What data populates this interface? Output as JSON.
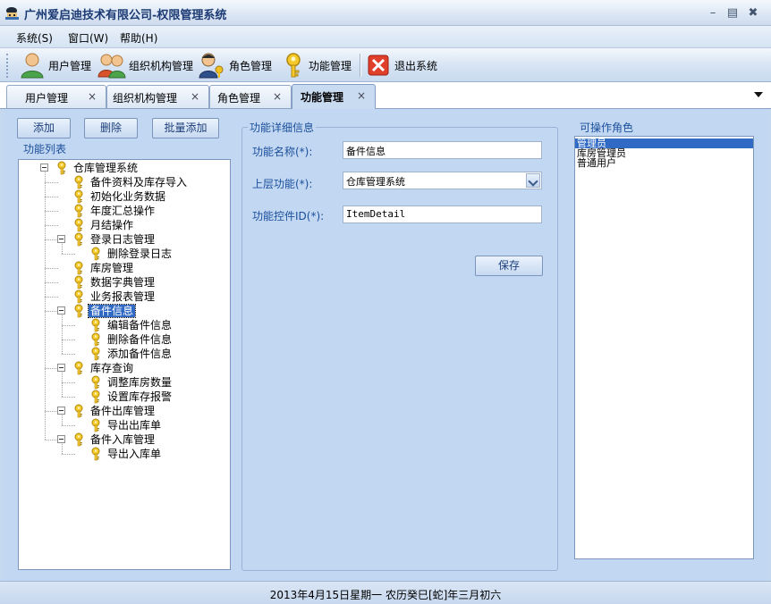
{
  "window": {
    "title": "广州爱启迪技术有限公司-权限管理系统"
  },
  "menu": [
    "系统(S)",
    "窗口(W)",
    "帮助(H)"
  ],
  "toolbar": {
    "user": "用户管理",
    "org": "组织机构管理",
    "role": "角色管理",
    "func": "功能管理",
    "exit": "退出系统"
  },
  "tabs": [
    {
      "label": "用户管理",
      "active": false
    },
    {
      "label": "组织机构管理",
      "active": false
    },
    {
      "label": "角色管理",
      "active": false
    },
    {
      "label": "功能管理",
      "active": true
    }
  ],
  "tab_close_glyph": "×",
  "actions": {
    "add": "添加",
    "delete": "删除",
    "batch_add": "批量添加"
  },
  "tree": {
    "title": "功能列表",
    "nodes": [
      {
        "label": "仓库管理系统",
        "depth": 0,
        "expandable": true
      },
      {
        "label": "备件资料及库存导入",
        "depth": 1
      },
      {
        "label": "初始化业务数据",
        "depth": 1
      },
      {
        "label": "年度汇总操作",
        "depth": 1
      },
      {
        "label": "月结操作",
        "depth": 1
      },
      {
        "label": "登录日志管理",
        "depth": 1,
        "expandable": true
      },
      {
        "label": "删除登录日志",
        "depth": 2
      },
      {
        "label": "库房管理",
        "depth": 1
      },
      {
        "label": "数据字典管理",
        "depth": 1
      },
      {
        "label": "业务报表管理",
        "depth": 1
      },
      {
        "label": "备件信息",
        "depth": 1,
        "expandable": true,
        "selected": true
      },
      {
        "label": "编辑备件信息",
        "depth": 2
      },
      {
        "label": "删除备件信息",
        "depth": 2
      },
      {
        "label": "添加备件信息",
        "depth": 2
      },
      {
        "label": "库存查询",
        "depth": 1,
        "expandable": true
      },
      {
        "label": "调整库房数量",
        "depth": 2
      },
      {
        "label": "设置库存报警",
        "depth": 2
      },
      {
        "label": "备件出库管理",
        "depth": 1,
        "expandable": true
      },
      {
        "label": "导出出库单",
        "depth": 2
      },
      {
        "label": "备件入库管理",
        "depth": 1,
        "expandable": true
      },
      {
        "label": "导出入库单",
        "depth": 2
      }
    ]
  },
  "detail": {
    "title": "功能详细信息",
    "name_label": "功能名称(*):",
    "name_value": "备件信息",
    "parent_label": "上层功能(*):",
    "parent_value": "仓库管理系统",
    "control_label": "功能控件ID(*):",
    "control_value": "ItemDetail",
    "save": "保存"
  },
  "roles": {
    "title": "可操作角色",
    "items": [
      {
        "label": "管理员",
        "selected": true
      },
      {
        "label": "库房管理员",
        "selected": false
      },
      {
        "label": "普通用户",
        "selected": false
      }
    ]
  },
  "status": "2013年4月15日星期一 农历癸巳[蛇]年三月初六",
  "colors": {
    "accent": "#316ac5",
    "label_blue": "#1b4f9b",
    "panel_bg": "#c2d7f2"
  }
}
